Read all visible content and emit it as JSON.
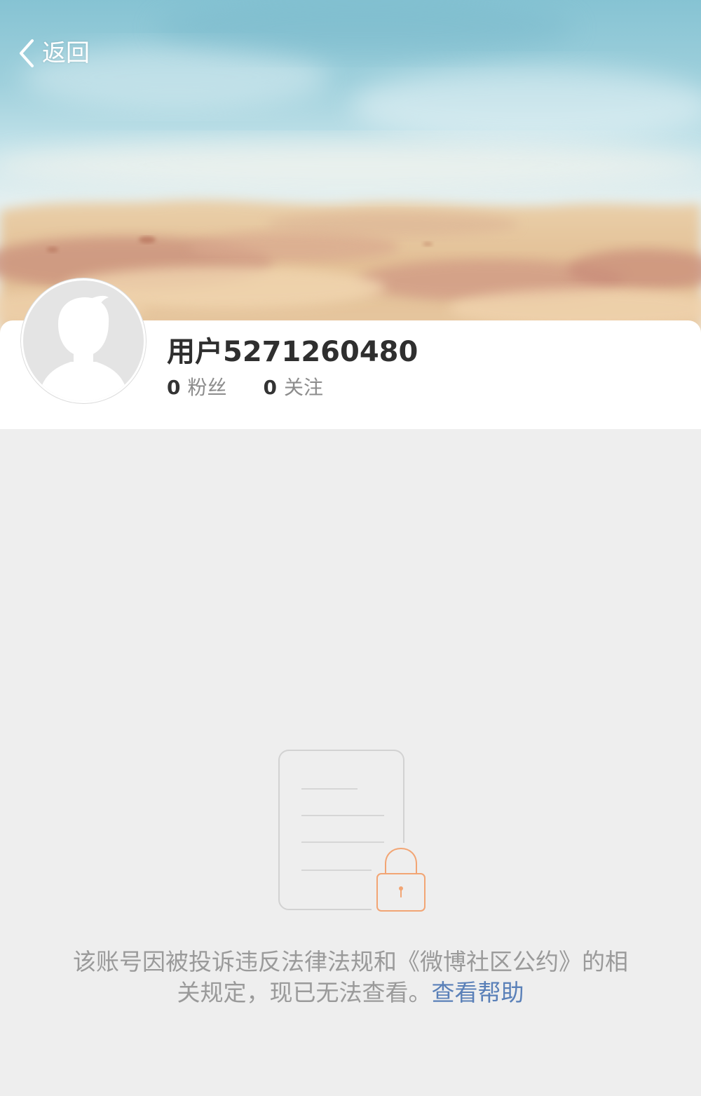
{
  "header": {
    "back_label": "返回"
  },
  "profile": {
    "username": "用户5271260480",
    "followers_count": "0",
    "followers_label": "粉丝",
    "following_count": "0",
    "following_label": "关注"
  },
  "notice": {
    "message": "该账号因被投诉违反法律法规和《微博社区公约》的相关规定，现已无法查看。",
    "help_link": "查看帮助"
  },
  "icons": {
    "back": "chevron-left-icon",
    "avatar": "avatar-placeholder-icon",
    "empty_state": "locked-document-icon"
  },
  "colors": {
    "page_background": "#eeeeee",
    "card_background": "#ffffff",
    "username_text": "#2f2f2f",
    "secondary_text": "#9a9a9a",
    "link": "#5a80b8",
    "lock_accent": "#f2a574"
  }
}
